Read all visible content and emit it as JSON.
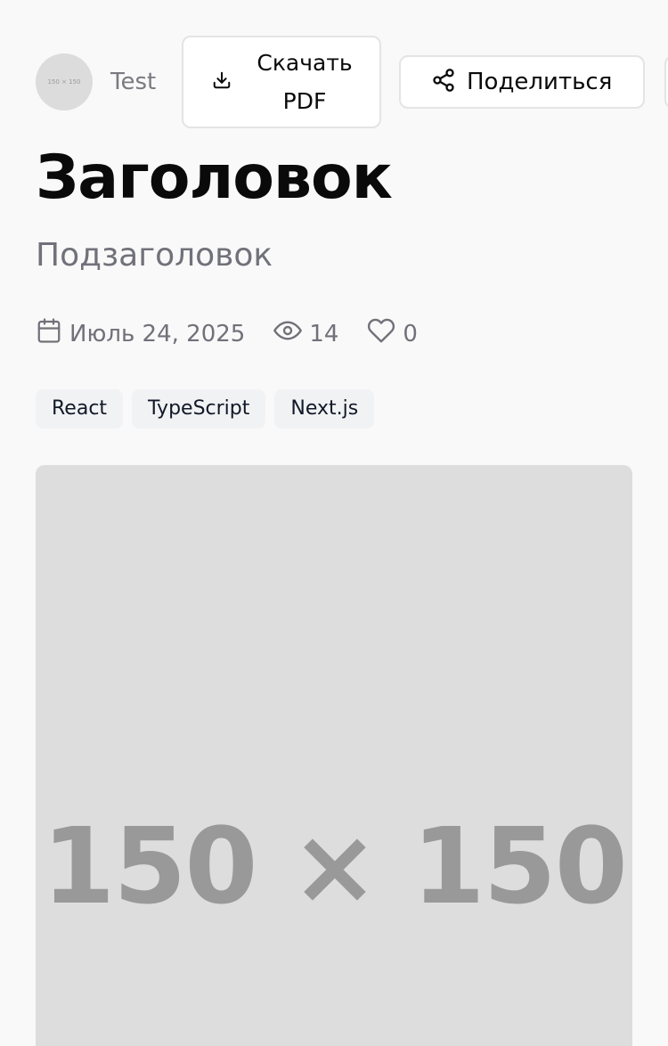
{
  "author": {
    "avatar_placeholder": "150 × 150",
    "name": "Test"
  },
  "actions": {
    "download_pdf_label": "Скачать PDF",
    "share_label": "Поделиться"
  },
  "article": {
    "title": "Заголовок",
    "subtitle": "Подзаголовок",
    "date": "Июль 24, 2025",
    "views": "14",
    "likes": "0",
    "tags": [
      "React",
      "TypeScript",
      "Next.js"
    ],
    "cover_placeholder": "150 × 150"
  },
  "icons": {
    "download": "download-icon",
    "share": "share-icon",
    "calendar": "calendar-icon",
    "views": "eye-icon",
    "likes": "heart-icon"
  },
  "colors": {
    "background": "#f9f9f9",
    "muted_text": "#71717a",
    "placeholder_bg": "#dddddd",
    "placeholder_text": "#999999",
    "tag_bg": "#f1f2f4"
  }
}
